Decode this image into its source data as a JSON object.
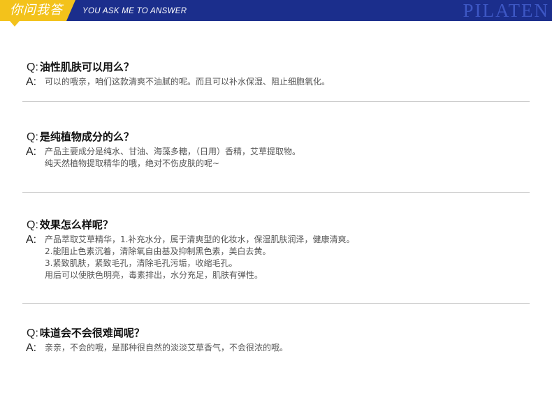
{
  "header": {
    "title_cn": "你问我答",
    "title_en": "YOU ASK ME TO ANSWER",
    "brand": "PILATEN",
    "colors": {
      "bar": "#1b2e8c",
      "tab": "#f3c21b",
      "brand": "#3d57c4"
    }
  },
  "faq": {
    "q_prefix": "Q:",
    "a_prefix": "A:",
    "items": [
      {
        "question": "油性肌肤可以用么？",
        "answer": [
          "可以的哦亲，咱们这款清爽不油腻的呢。而且可以补水保湿、阻止细胞氧化。"
        ]
      },
      {
        "question": "是纯植物成分的么？",
        "answer": [
          "产品主要成分是纯水、甘油、海藻多糖，（日用）香精，艾草提取物。",
          "纯天然植物提取精华的哦，绝对不伤皮肤的呢~"
        ]
      },
      {
        "question": "效果怎么样呢？",
        "answer": [
          "产品萃取艾草精华，1.补充水分，属于清爽型的化妆水，保湿肌肤润泽，健康清爽。",
          "2.能阻止色素沉着，清除氧自由基及抑制黑色素，美白去黄。",
          "3.紧致肌肤，紧致毛孔，清除毛孔污垢，收缩毛孔。",
          "用后可以使肤色明亮，毒素排出，水分充足，肌肤有弹性。"
        ]
      },
      {
        "question": "味道会不会很难闻呢？",
        "answer": [
          "亲亲，不会的哦，是那种很自然的淡淡艾草香气，不会很浓的哦。"
        ]
      }
    ]
  }
}
